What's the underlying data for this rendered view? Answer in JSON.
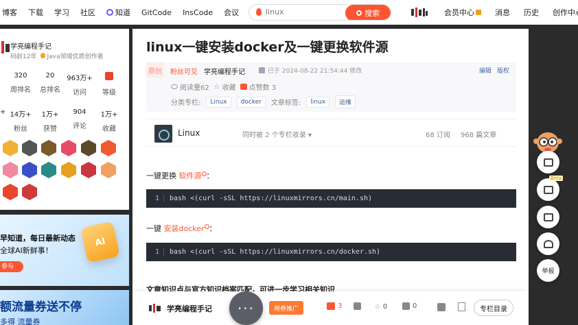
{
  "topnav": {
    "items": [
      "博客",
      "下载",
      "学习",
      "社区",
      "知道",
      "GitCode",
      "InsCode",
      "会议"
    ],
    "search_value": "linux",
    "search_button": "搜索",
    "right_items": [
      "会员中心",
      "消息",
      "历史",
      "创作中心"
    ]
  },
  "sidebar": {
    "author": "学亮编程手记",
    "code_age": "码龄12年",
    "honor": "Java领域优质创作者",
    "stats_row1": [
      {
        "value": "320",
        "label": "周排名"
      },
      {
        "value": "20",
        "label": "总排名"
      },
      {
        "value": "963万+",
        "label": "访问"
      },
      {
        "value": "",
        "label": "等级"
      }
    ],
    "stats_row2": [
      {
        "value": "14万+",
        "label": "粉丝"
      },
      {
        "value": "1万+",
        "label": "获赞"
      },
      {
        "value": "904",
        "label": "评论"
      },
      {
        "value": "1万+",
        "label": "收藏"
      }
    ],
    "banner1": {
      "line1": "早知道，每日最新动态",
      "line2": "全球AI新鲜事！",
      "cta": "参与",
      "tile": "AI"
    },
    "banner2": {
      "line1": "额流量券送不停",
      "line2": "多得  流量券"
    }
  },
  "article": {
    "title": "linux一键安装docker及一键更换软件源",
    "original": "原创",
    "fans_only": "粉丝可见",
    "author": "学亮编程手记",
    "time": "已于 2024-08-22 21:54:44 修改",
    "edit": "编辑",
    "copyright": "版权",
    "reads": "阅读量62",
    "collect": "收藏",
    "likes": "点赞数 3",
    "column_label": "分类专栏:",
    "column_tag": "Linux",
    "column_tag2": "docker",
    "tags_label": "文章标签:",
    "tag1": "linux",
    "tag2": "运维",
    "col_name": "Linux",
    "col_info": "同时被 2 个专栏收录",
    "col_sub": "68 订阅",
    "col_arts": "968 篇文章",
    "p1_prefix": "一键更换 ",
    "p1_link": "软件源",
    "p1_suffix": "：",
    "code1_ln": "1",
    "code1": "bash <(curl -sSL https://linuxmirrors.cn/main.sh)",
    "p2_prefix": "一键 ",
    "p2_link": "安装docker",
    "p2_suffix": "：",
    "code2_ln": "1",
    "code2": "bash <(curl -sSL https://linuxmirrors.cn/docker.sh)",
    "section_heading": "文章知识点与官方知识档案匹配，可进一步学习相关知识"
  },
  "bottombar": {
    "author": "学亮编程手记",
    "promo": "用券推广",
    "like_count": "3",
    "collect_count": "0",
    "comment_count": "0",
    "toc": "专栏目录",
    "fab": "···"
  },
  "floating": {
    "beta": "Beta",
    "report": "举报"
  },
  "colors": {
    "brand": "#fc5531",
    "code_bg": "#282c34",
    "page_bg": "#2b2b2b"
  }
}
